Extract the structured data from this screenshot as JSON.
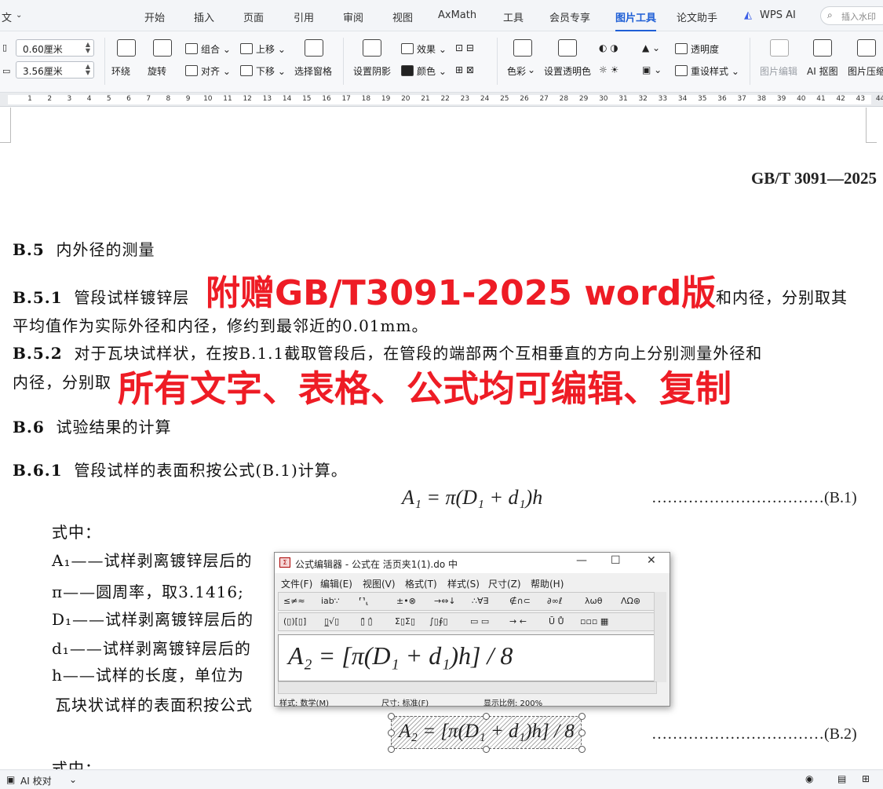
{
  "menubar": {
    "left_label": "文",
    "items": [
      "开始",
      "插入",
      "页面",
      "引用",
      "审阅",
      "视图",
      "AxMath",
      "工具",
      "会员专享",
      "图片工具",
      "论文助手"
    ],
    "active": "图片工具",
    "wps_ai": "WPS AI",
    "search_placeholder": "插入水印"
  },
  "ribbon": {
    "width_value": "0.60厘米",
    "height_value": "3.56厘米",
    "wrap": "环绕",
    "rotate": "旋转",
    "group": "组合",
    "align": "对齐",
    "move_up": "上移",
    "move_down": "下移",
    "select_pane": "选择窗格",
    "set_shadow": "设置阴影",
    "effect": "效果",
    "color": "颜色",
    "color_mode": "色彩",
    "set_transparent_color": "设置透明色",
    "transparency": "透明度",
    "reset_style": "重设样式",
    "image_edit": "图片编辑",
    "ai_cutout": "AI 抠图",
    "image_compress": "图片压缩"
  },
  "ruler": {
    "ticks": [
      "1",
      "2",
      "3",
      "4",
      "5",
      "6",
      "7",
      "8",
      "9",
      "10",
      "11",
      "12",
      "13",
      "14",
      "15",
      "16",
      "17",
      "18",
      "19",
      "20",
      "21",
      "22",
      "23",
      "24",
      "25",
      "26",
      "27",
      "28",
      "29",
      "30",
      "31",
      "32",
      "33",
      "34",
      "35",
      "36",
      "37",
      "38",
      "39",
      "40",
      "41",
      "42",
      "43",
      "44"
    ]
  },
  "doc": {
    "standard": "GB/T 3091—2025",
    "b5_num": "B.5",
    "b5_title": "内外径的测量",
    "b51_num": "B.5.1",
    "b51_line1": "管段试样镀锌层",
    "b51_line1_end": "和内径，分别取其",
    "b51_line2": "平均值作为实际外径和内径，修约到最邻近的0.01mm。",
    "b52_num": "B.5.2",
    "b52_line1": "对于瓦块试样状，在按B.1.1截取管段后，在管段的端部两个互相垂直的方向上分别测量外径和",
    "b52_line2": "内径，分别取",
    "b6_num": "B.6",
    "b6_title": "试验结果的计算",
    "b61_num": "B.6.1",
    "b61_text": "管段试样的表面积按公式(B.1)计算。",
    "formula1": "A₁ = π(D₁ + d₁)h",
    "formula1_num": "……………………………(B.1)",
    "where": "式中：",
    "var_a1": "A₁——试样剥离镀锌层后的",
    "var_pi": "π——圆周率，取3.1416;",
    "var_d1": "D₁——试样剥离镀锌层后的",
    "var_sd1": "d₁——试样剥离镀锌层后的",
    "var_h": "h——试样的长度，单位为",
    "tile_text": "瓦块状试样的表面积按公式",
    "formula2": "A₂ = [π(D₁ + d₁)h] / 8",
    "formula2_num": "……………………………(B.2)",
    "where2": "式中："
  },
  "overlay": {
    "line1": "附赠GB/T3091-2025 word版",
    "line2": "所有文字、表格、公式均可编辑、复制"
  },
  "dialog": {
    "title": "公式编辑器 - 公式在 活页夹1(1).do 中",
    "app_icon": "Σ",
    "menu": [
      "文件(F)",
      "编辑(E)",
      "视图(V)",
      "格式(T)",
      "样式(S)",
      "尺寸(Z)",
      "帮助(H)"
    ],
    "toolbar1": [
      "≤≠≈",
      "ⅰab∵",
      "⸢⸣⸤",
      "±•⊗",
      "→⇔↓",
      "∴∀∃",
      "∉∩⊂",
      "∂∞ℓ",
      "λωθ",
      "ΛΩ⊛"
    ],
    "toolbar2": [
      "(▯)[▯]",
      "▯̲√▯",
      "▯̄ ▯̂",
      "Σ▯Σ▯",
      "∫▯∮▯",
      "▭ ▭",
      "→ ←",
      "Ū Ů",
      "▫▫▫ ▦"
    ],
    "equation": "A₂ = [π(D₁ + d₁)h] / 8",
    "status_style": "样式: 数学(M)",
    "status_size": "尺寸: 标准(F)",
    "status_zoom": "显示比例: 200%"
  },
  "statusbar": {
    "ai_check": "AI 校对"
  }
}
